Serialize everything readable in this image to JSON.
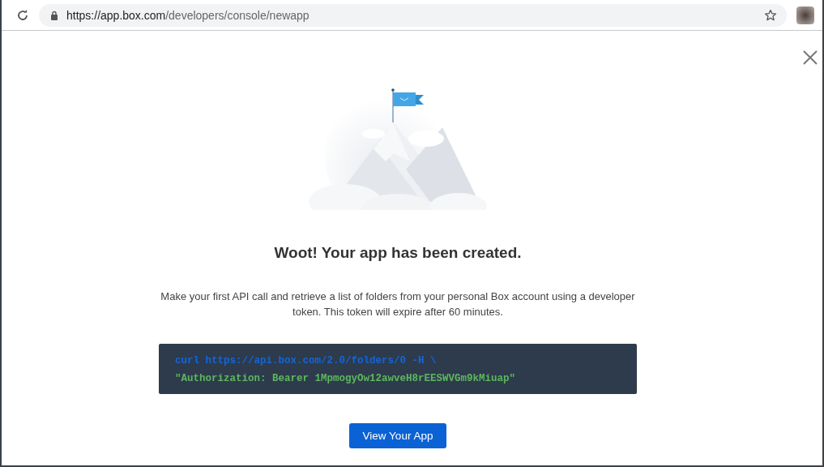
{
  "browser": {
    "url_host": "https://app.box.com",
    "url_path": "/developers/console/newapp"
  },
  "modal": {
    "title": "Woot! Your app has been created.",
    "description": "Make your first API call and retrieve a list of folders from your personal Box account using a developer token. This token will expire after 60 minutes.",
    "code_lines": [
      "curl https://api.box.com/2.0/folders/0 -H \\",
      "\"Authorization: Bearer 1MpmogyOw12awveH8rEESWVGm9kMiuap\""
    ],
    "button": "View Your App"
  }
}
